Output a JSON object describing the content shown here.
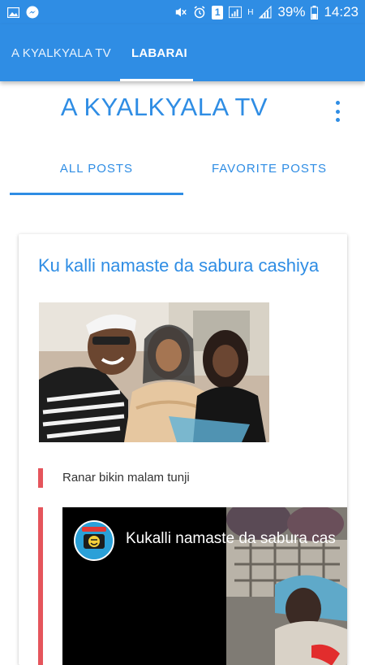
{
  "status_bar": {
    "battery": "39%",
    "time": "14:23",
    "sim_label": "1",
    "network_h": "H"
  },
  "app_tabs": [
    {
      "label": "A KYALKYALA TV"
    },
    {
      "label": "LABARAI"
    }
  ],
  "site_title": "A KYALKYALA TV",
  "post_tabs": [
    {
      "label": "ALL POSTS"
    },
    {
      "label": "FAVORITE POSTS"
    }
  ],
  "post": {
    "title": "Ku kalli namaste da sabura cashiya",
    "quote": "Ranar bikin malam tunji",
    "video_title": "Kukalli namaste da sabura cas"
  },
  "colors": {
    "primary": "#2f8de4",
    "quote_bar": "#e5555c"
  },
  "icons": [
    "gallery-icon",
    "messenger-icon",
    "mute-icon",
    "alarm-icon",
    "sim-icon",
    "signal-icon",
    "more-vert-icon",
    "play-logo-icon"
  ]
}
